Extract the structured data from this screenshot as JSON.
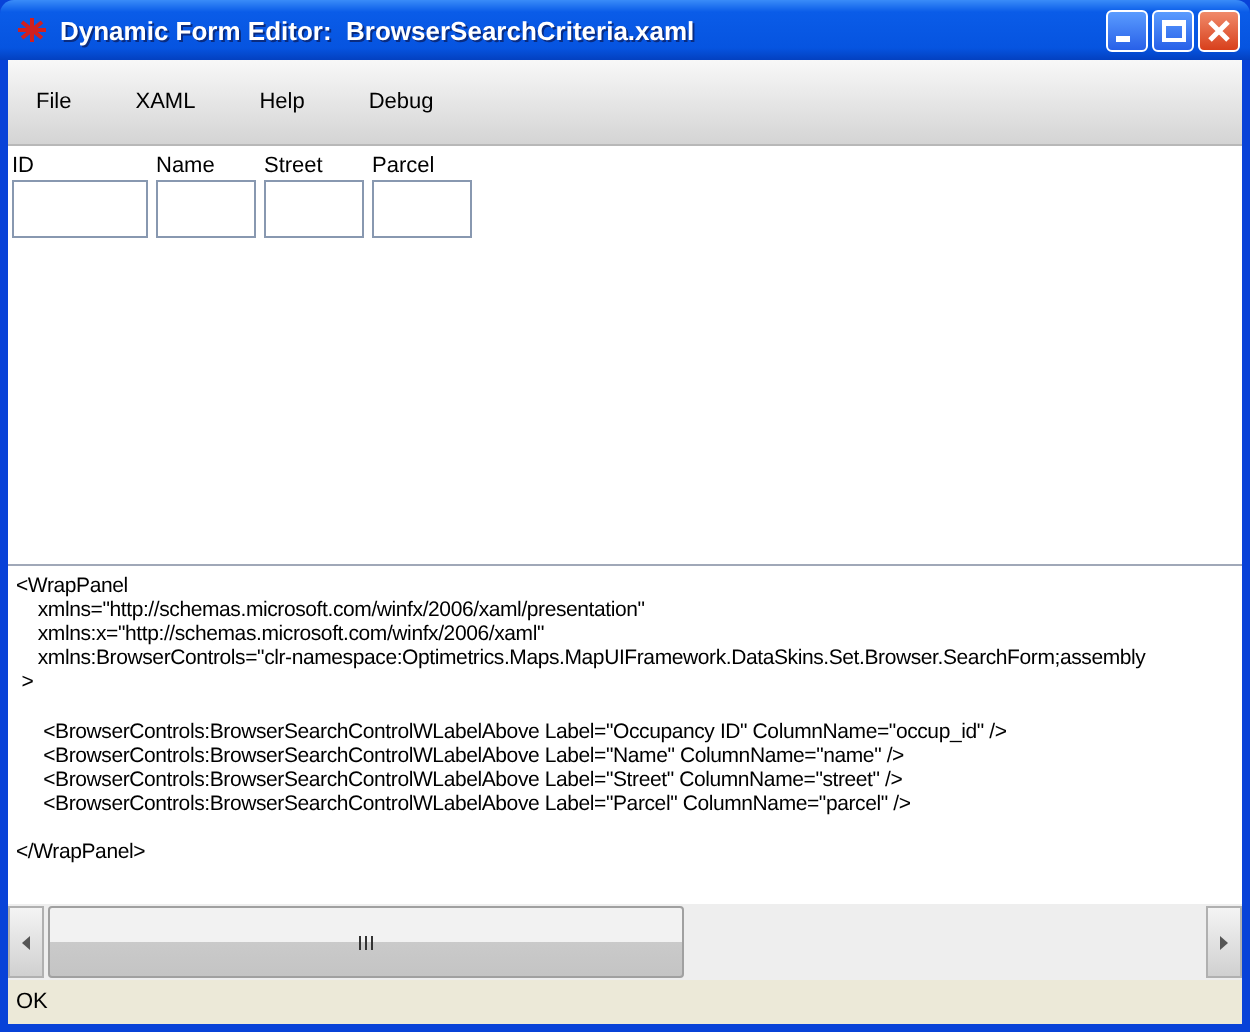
{
  "window": {
    "title": "Dynamic Form Editor:  BrowserSearchCriteria.xaml"
  },
  "menu": [
    "File",
    "XAML",
    "Help",
    "Debug"
  ],
  "fields": [
    {
      "label": "ID",
      "wide": true
    },
    {
      "label": "Name",
      "wide": false
    },
    {
      "label": "Street",
      "wide": false
    },
    {
      "label": "Parcel",
      "wide": false
    }
  ],
  "code": "<WrapPanel\n    xmlns=\"http://schemas.microsoft.com/winfx/2006/xaml/presentation\"\n    xmlns:x=\"http://schemas.microsoft.com/winfx/2006/xaml\"\n    xmlns:BrowserControls=\"clr-namespace:Optimetrics.Maps.MapUIFramework.DataSkins.Set.Browser.SearchForm;assembly\n >\n\n     <BrowserControls:BrowserSearchControlWLabelAbove Label=\"Occupancy ID\" ColumnName=\"occup_id\" />\n     <BrowserControls:BrowserSearchControlWLabelAbove Label=\"Name\" ColumnName=\"name\" />\n     <BrowserControls:BrowserSearchControlWLabelAbove Label=\"Street\" ColumnName=\"street\" />\n     <BrowserControls:BrowserSearchControlWLabelAbove Label=\"Parcel\" ColumnName=\"parcel\" />\n\n</WrapPanel>",
  "status_bar": "OK"
}
